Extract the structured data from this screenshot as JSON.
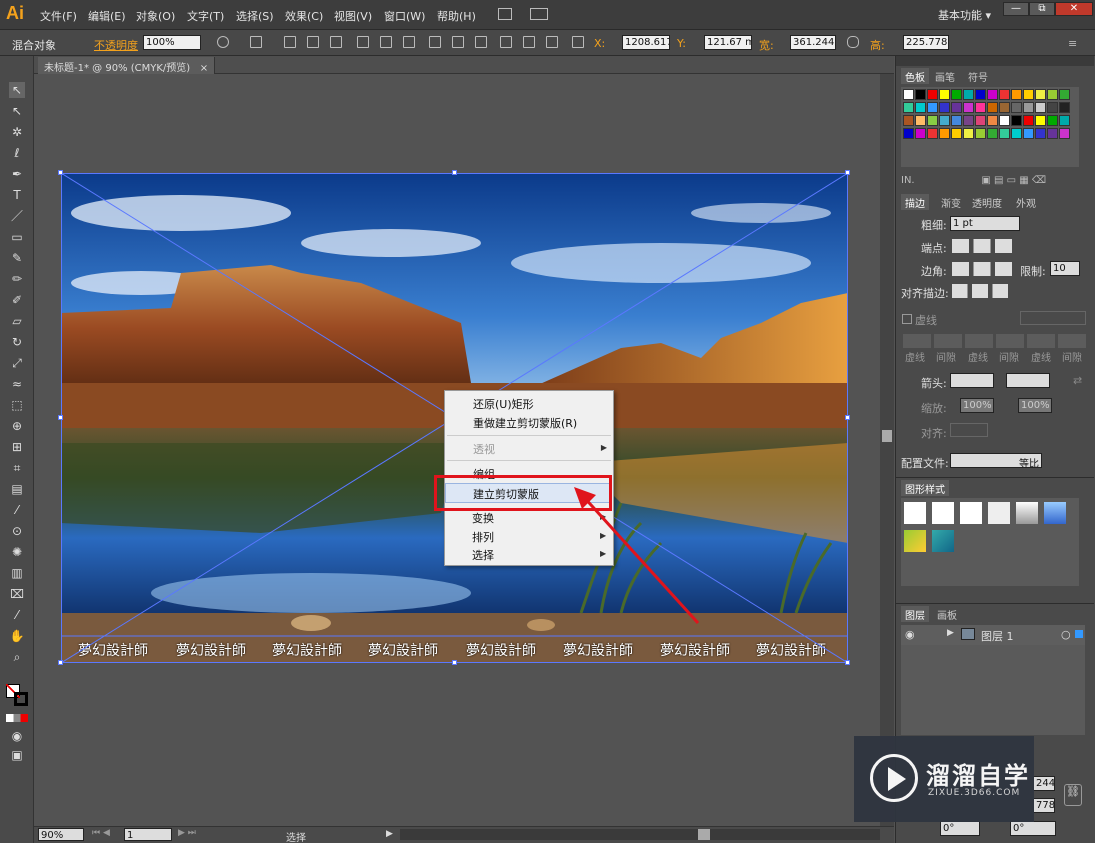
{
  "app": {
    "logo": "Ai"
  },
  "menu": [
    "文件(F)",
    "编辑(E)",
    "对象(O)",
    "文字(T)",
    "选择(S)",
    "效果(C)",
    "视图(V)",
    "窗口(W)",
    "帮助(H)"
  ],
  "workspace": "基本功能",
  "win_buttons": {
    "minimize": "—",
    "restore": "⧉",
    "close": "✕"
  },
  "control": {
    "selection_type": "混合对象",
    "opacity_label": "不透明度",
    "opacity_value": "100%",
    "x_label": "X:",
    "x": "1208.617",
    "y_label": "Y:",
    "y": "121.67 m",
    "w_label": "宽:",
    "w": "361.244",
    "h_label": "高:",
    "h": "225.778"
  },
  "doc_tab": {
    "title": "未标题-1* @ 90% (CMYK/预览)",
    "close": "×"
  },
  "watermark_text": [
    "夢幻設計師",
    "夢幻設計師",
    "夢幻設計師",
    "夢幻設計師",
    "夢幻設計師",
    "夢幻設計師",
    "夢幻設計師",
    "夢幻設計師"
  ],
  "context_menu": {
    "items": [
      {
        "label": "还原(U)矩形",
        "disabled": false,
        "submenu": false
      },
      {
        "label": "重做建立剪切蒙版(R)",
        "disabled": false,
        "submenu": false
      },
      {
        "label": "透视",
        "disabled": true,
        "submenu": true
      },
      {
        "label": "编组",
        "disabled": false,
        "submenu": false
      },
      {
        "label": "建立剪切蒙版",
        "disabled": false,
        "submenu": false,
        "highlighted": true
      },
      {
        "label": "变换",
        "disabled": false,
        "submenu": true
      },
      {
        "label": "排列",
        "disabled": false,
        "submenu": true
      },
      {
        "label": "选择",
        "disabled": false,
        "submenu": true
      }
    ]
  },
  "panels": {
    "swatches": {
      "tabs": [
        "色板",
        "画笔",
        "符号"
      ]
    },
    "stroke": {
      "tabs": [
        "描边",
        "渐变",
        "透明度",
        "外观"
      ],
      "weight_label": "粗细:",
      "weight_value": "1 pt",
      "cap_label": "端点:",
      "corner_label": "边角:",
      "limit_label": "限制:",
      "limit_value": "10",
      "align_label": "对齐描边:",
      "dashed_label": "虚线",
      "dash_labels": [
        "虚线",
        "间隙",
        "虚线",
        "间隙",
        "虚线",
        "间隙"
      ],
      "arrow_label": "箭头:",
      "scale_label": "缩放:",
      "scale_1": "100%",
      "scale_2": "100%",
      "align2_label": "对齐:",
      "profile_label": "配置文件:",
      "profile_value": "等比"
    },
    "graphic_styles": {
      "tab": "图形样式"
    },
    "layers": {
      "tabs": [
        "图层",
        "画板"
      ],
      "layer_name": "图层 1"
    },
    "bottom_fields": {
      "angle1": "0°",
      "angle2": "0°",
      "num1": "244",
      "num2": "778"
    }
  },
  "status": {
    "zoom": "90%",
    "page": "1",
    "tool": "选择"
  },
  "brand": {
    "name": "溜溜自学",
    "url": "ZIXUE.3D66.COM"
  },
  "colors": {
    "accent": "#f4a21c",
    "selection": "#5a78ff",
    "annotation": "#e0141c"
  }
}
